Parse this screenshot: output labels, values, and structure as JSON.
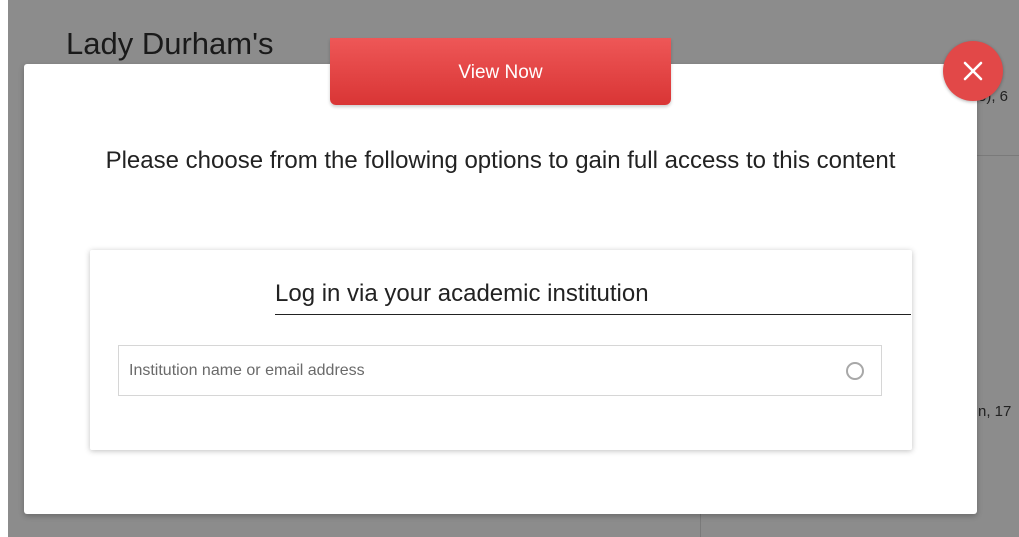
{
  "background": {
    "title": "Lady Durham's",
    "snippets": [
      "o), 6",
      "n, 17"
    ]
  },
  "modal": {
    "view_now_label": "View Now",
    "heading": "Please choose from the following options to gain full access to this content",
    "card": {
      "title": "Log in via your academic institution",
      "search_placeholder": "Institution name or email address"
    },
    "icons": {
      "close": "close-icon",
      "loading": "loading-spinner-icon"
    },
    "colors": {
      "accent": "#e24848",
      "button_top": "#ee5757",
      "button_bottom": "#d93535"
    }
  }
}
